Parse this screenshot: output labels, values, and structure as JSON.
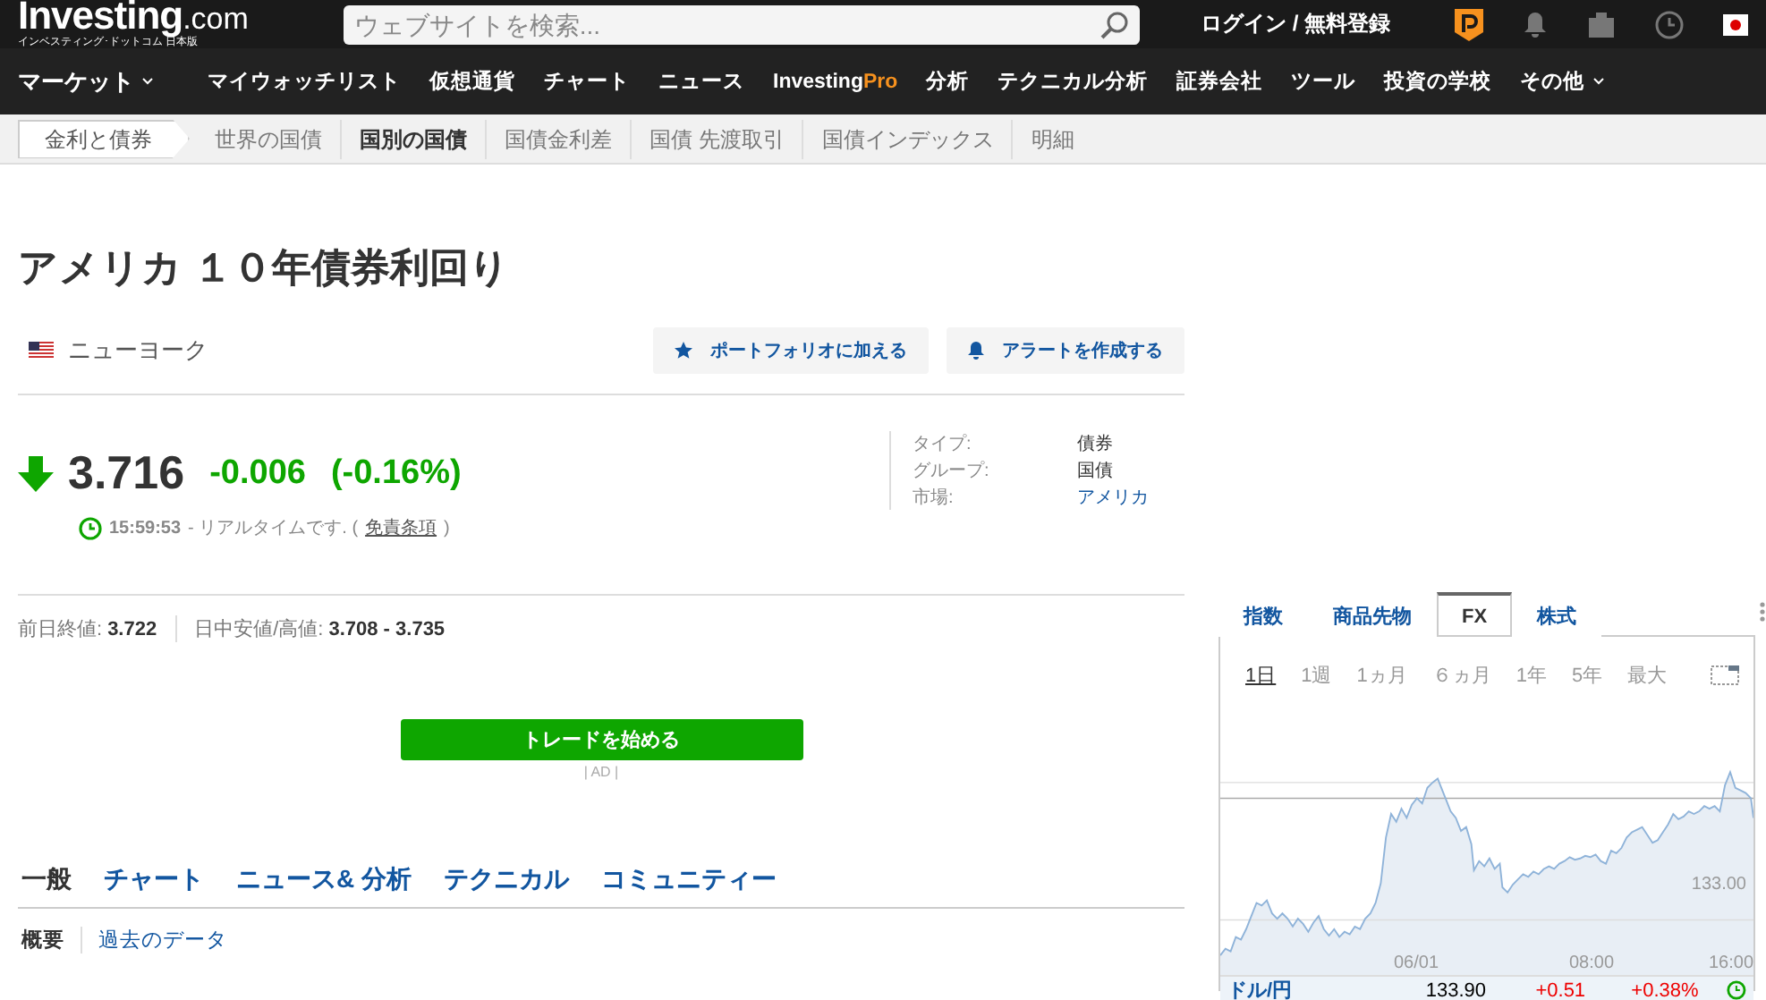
{
  "header": {
    "logo": {
      "main": "Investing",
      "suffix": ".com",
      "subtitle": "インベスティング･ドットコム 日本版"
    },
    "search": {
      "placeholder": "ウェブサイトを検索..."
    },
    "login": "ログイン / 無料登録"
  },
  "nav": [
    {
      "label": "マーケット",
      "caret": true,
      "kind": "plain"
    },
    {
      "label": "マイウォッチリスト",
      "caret": false,
      "kind": "plain"
    },
    {
      "label": "仮想通貨",
      "caret": false,
      "kind": "plain"
    },
    {
      "label": "チャート",
      "caret": false,
      "kind": "plain"
    },
    {
      "label": "ニュース",
      "caret": false,
      "kind": "plain"
    },
    {
      "label": "Investing",
      "suffix": "Pro",
      "caret": false,
      "kind": "pro"
    },
    {
      "label": "分析",
      "caret": false,
      "kind": "plain"
    },
    {
      "label": "テクニカル分析",
      "caret": false,
      "kind": "plain"
    },
    {
      "label": "証券会社",
      "caret": false,
      "kind": "plain"
    },
    {
      "label": "ツール",
      "caret": false,
      "kind": "plain"
    },
    {
      "label": "投資の学校",
      "caret": false,
      "kind": "plain"
    },
    {
      "label": "その他",
      "caret": true,
      "kind": "plain"
    }
  ],
  "subnav": [
    {
      "label": "金利と債券",
      "kind": "root",
      "selected": false
    },
    {
      "label": "世界の国債",
      "kind": "item",
      "selected": false
    },
    {
      "label": "国別の国債",
      "kind": "item",
      "selected": true
    },
    {
      "label": "国債金利差",
      "kind": "item",
      "selected": false
    },
    {
      "label": "国債 先渡取引",
      "kind": "item",
      "selected": false
    },
    {
      "label": "国債インデックス",
      "kind": "item",
      "selected": false
    },
    {
      "label": "明細",
      "kind": "item",
      "selected": false
    }
  ],
  "instrument": {
    "title": "アメリカ １０年債券利回り",
    "exchange": "ニューヨーク",
    "actions": [
      {
        "label": "ポートフォリオに加える",
        "kind": "star"
      },
      {
        "label": "アラートを作成する",
        "kind": "bell"
      }
    ],
    "price": "3.716",
    "change": "-0.006",
    "change_pct": "(-0.16%)",
    "time": "15:59:53",
    "time_note": "- リアルタイムです. (",
    "disclaimer": "免責条項",
    "time_close": ")",
    "info": [
      {
        "label": "タイプ:",
        "value": "債券",
        "link": false
      },
      {
        "label": "グループ:",
        "value": "国債",
        "link": false
      },
      {
        "label": "市場:",
        "value": "アメリカ",
        "link": true
      }
    ],
    "stats": [
      {
        "label": "前日終値:",
        "value": "3.722"
      },
      {
        "label": "日中安値/高値:",
        "value": "3.708 - 3.735"
      }
    ]
  },
  "ad": {
    "button": "トレードを始める",
    "label": "| AD |"
  },
  "tabs": [
    {
      "label": "一般",
      "selected": true
    },
    {
      "label": "チャート",
      "selected": false
    },
    {
      "label": "ニュース& 分析",
      "selected": false
    },
    {
      "label": "テクニカル",
      "selected": false
    },
    {
      "label": "コミュニティー",
      "selected": false
    }
  ],
  "subtabs": [
    {
      "label": "概要",
      "selected": true
    },
    {
      "label": "過去のデータ",
      "selected": false
    }
  ],
  "widget": {
    "tabs": [
      {
        "label": "指数",
        "selected": false
      },
      {
        "label": "商品先物",
        "selected": false
      },
      {
        "label": "FX",
        "selected": true
      },
      {
        "label": "株式",
        "selected": false
      }
    ],
    "ranges": [
      {
        "label": "1日",
        "selected": true
      },
      {
        "label": "1週",
        "selected": false
      },
      {
        "label": "1ヵ月",
        "selected": false
      },
      {
        "label": "６ヵ月",
        "selected": false
      },
      {
        "label": "1年",
        "selected": false
      },
      {
        "label": "5年",
        "selected": false
      },
      {
        "label": "最大",
        "selected": false
      }
    ],
    "y_label": "133.00",
    "x_labels": [
      "06/01",
      "08:00",
      "16:00"
    ],
    "quote": {
      "name": "ドル/円",
      "price": "133.90",
      "change": "+0.51",
      "change_pct": "+0.38%"
    }
  }
}
